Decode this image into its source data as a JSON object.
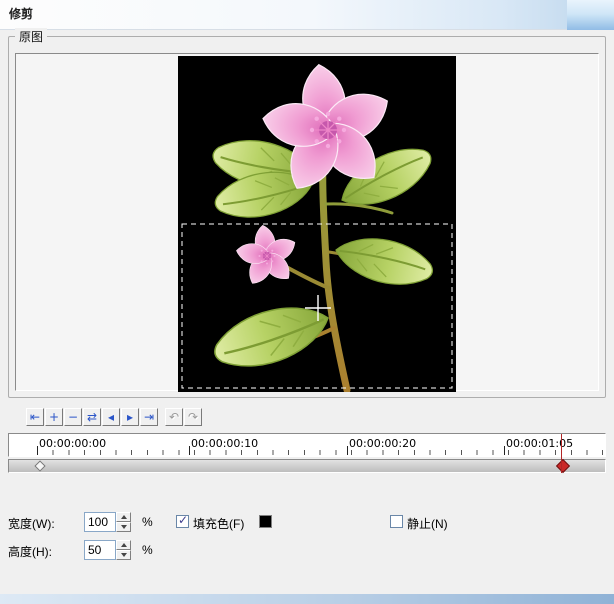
{
  "window": {
    "title": "修剪"
  },
  "preview": {
    "group_label": "原图"
  },
  "toolbar": {
    "buttons": [
      {
        "name": "jump-start",
        "glyph": "⇤",
        "enabled": true
      },
      {
        "name": "mark-in",
        "glyph": "+",
        "enabled": true
      },
      {
        "name": "mark-out",
        "glyph": "−",
        "enabled": true
      },
      {
        "name": "swap-marks",
        "glyph": "⇄",
        "enabled": true
      },
      {
        "name": "step-back",
        "glyph": "◂",
        "enabled": true
      },
      {
        "name": "step-forward",
        "glyph": "▸",
        "enabled": true
      },
      {
        "name": "jump-end",
        "glyph": "⇥",
        "enabled": true
      },
      {
        "name": "prev-frame",
        "glyph": "↶",
        "enabled": false
      },
      {
        "name": "next-frame",
        "glyph": "↷",
        "enabled": false
      }
    ]
  },
  "timeline": {
    "labels": [
      "00:00:00:00",
      "00:00:00:10",
      "00:00:00:20",
      "00:00:01:05"
    ]
  },
  "controls": {
    "width": {
      "label": "宽度(W):",
      "value": "100",
      "unit": "%"
    },
    "height": {
      "label": "高度(H):",
      "value": "50",
      "unit": "%"
    },
    "fill": {
      "label": "填充色(F)",
      "checked": true,
      "swatch_color": "#000000",
      "swatch_style": "background:#000000"
    },
    "still": {
      "label": "静止(N)",
      "checked": false
    }
  }
}
